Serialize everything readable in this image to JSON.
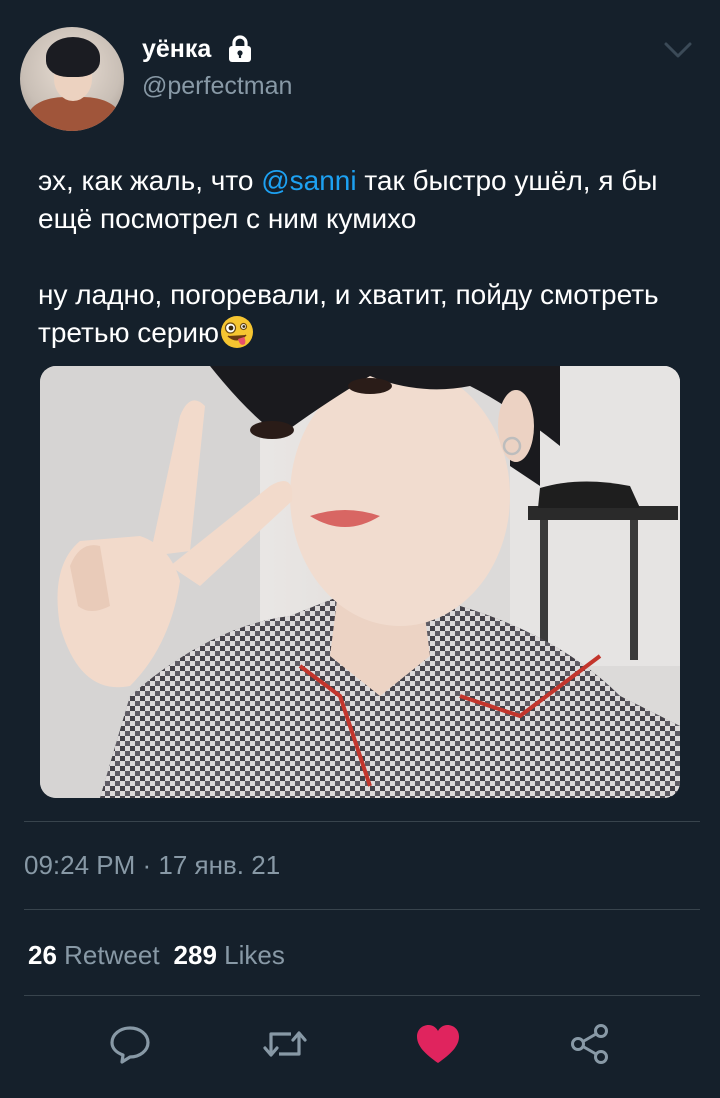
{
  "user": {
    "display_name": "уёнка",
    "handle": "@perfectman",
    "protected_icon": "lock-icon",
    "avatar_icon": "avatar"
  },
  "menu": {
    "icon": "chevron-down-icon"
  },
  "tweet": {
    "line1_before": "эх, как жаль, что ",
    "mention": "@sanni",
    "line1_after": " так быстро ушёл, я бы ещё посмотрел с ним кумихо",
    "paragraph2": "ну ладно, погоревали, и хватит, пойду смотреть третью серию",
    "emoji": "zany-face-emoji-icon"
  },
  "media": {
    "icon": "photo"
  },
  "meta": {
    "timestamp": "09:24 PM · 17 янв. 21"
  },
  "stats": {
    "retweets_count": "26",
    "retweets_label": "Retweet",
    "likes_count": "289",
    "likes_label": "Likes"
  },
  "actions": [
    {
      "name": "reply",
      "icon": "comment-icon"
    },
    {
      "name": "retweet",
      "icon": "retweet-icon"
    },
    {
      "name": "like",
      "icon": "heart-icon",
      "active": true
    },
    {
      "name": "share",
      "icon": "share-icon"
    }
  ],
  "colors": {
    "background": "#15202b",
    "text": "#ffffff",
    "secondary": "#8899a6",
    "accent": "#1da1f2",
    "like": "#e0245e",
    "divider": "#38444d"
  }
}
